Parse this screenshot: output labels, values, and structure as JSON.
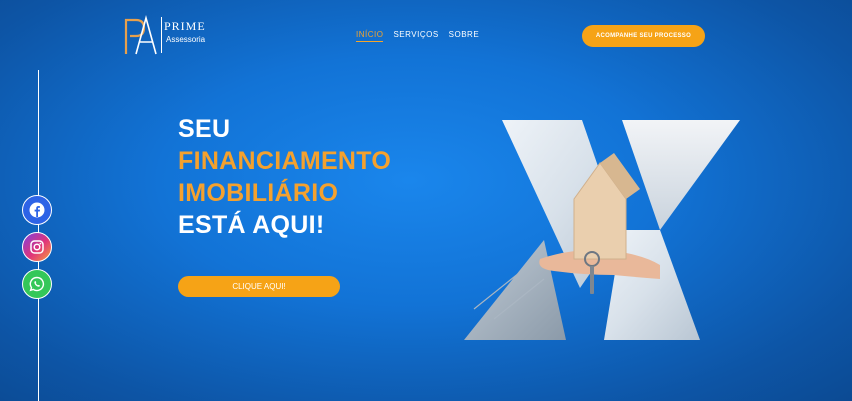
{
  "logo": {
    "title": "PRIME",
    "subtitle": "Assessoria"
  },
  "nav": {
    "items": [
      "INÍCIO",
      "SERVIÇOS",
      "SOBRE"
    ],
    "active": "INÍCIO"
  },
  "header_cta": "ACOMPANHE SEU PROCESSO",
  "hero": {
    "line1": "SEU",
    "line2": "FINANCIAMENTO",
    "line3": "IMOBILIÁRIO",
    "line4": "ESTÁ AQUI!"
  },
  "hero_cta": "CLIQUE AQUI!",
  "social": [
    {
      "name": "facebook",
      "icon": "facebook-icon",
      "color": "#2d63e6"
    },
    {
      "name": "instagram",
      "icon": "instagram-icon",
      "color": "#e0357a"
    },
    {
      "name": "whatsapp",
      "icon": "whatsapp-icon",
      "color": "#34c759"
    }
  ],
  "colors": {
    "accent": "#f6a316",
    "background": "#1273d6",
    "text": "#ffffff"
  }
}
